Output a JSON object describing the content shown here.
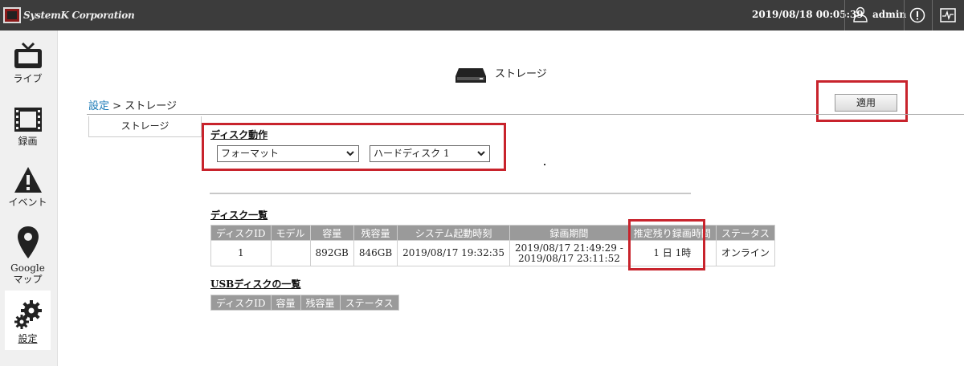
{
  "header": {
    "logo_text": "SystemK Corporation",
    "datetime": "2019/08/18 00:05:39",
    "user": "admin",
    "alert_icon": "exclamation-circle-icon",
    "monitor_icon": "monitor-pulse-icon"
  },
  "sidebar": {
    "items": [
      {
        "label": "ライブ",
        "icon": "tv-icon"
      },
      {
        "label": "録画",
        "icon": "film-icon"
      },
      {
        "label": "イベント",
        "icon": "warning-icon"
      },
      {
        "label": "Google",
        "label2": "マップ",
        "icon": "map-pin-icon"
      },
      {
        "label": "設定",
        "icon": "gears-icon",
        "active": true
      }
    ]
  },
  "page": {
    "title": "ストレージ",
    "title_icon": "storage-drive-icon",
    "breadcrumb_link": "設定",
    "breadcrumb_sep": ">",
    "breadcrumb_current": "ストレージ",
    "apply_label": "適用",
    "tab_label": "ストレージ"
  },
  "disk_action": {
    "title": "ディスク動作",
    "action_value": "フォーマット",
    "disk_value": "ハードディスク 1"
  },
  "disk_list": {
    "title": "ディスク一覧",
    "headers": [
      "ディスクID",
      "モデル",
      "容量",
      "残容量",
      "システム起動時刻",
      "録画期間",
      "推定残り録画時間",
      "ステータス"
    ],
    "rows": [
      {
        "id": "1",
        "model": "",
        "capacity": "892GB",
        "remaining": "846GB",
        "boot_time": "2019/08/17 19:32:35",
        "period_start": "2019/08/17 21:49:29 -",
        "period_end": "2019/08/17 23:11:52",
        "est_remaining": "1 日 1時",
        "status": "オンライン"
      }
    ]
  },
  "usb_list": {
    "title": "USBディスクの一覧",
    "headers": [
      "ディスクID",
      "容量",
      "残容量",
      "ステータス"
    ]
  },
  "colors": {
    "topbar": "#3c3c3c",
    "highlight": "#c8232c",
    "link": "#1a7ab7",
    "table_header": "#9a9a9a"
  }
}
